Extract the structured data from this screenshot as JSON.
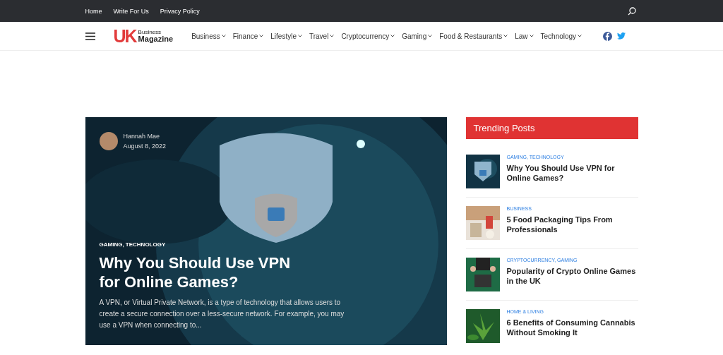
{
  "top_bar": {
    "links": [
      {
        "label": "Home"
      },
      {
        "label": "Write For Us"
      },
      {
        "label": "Privacy Policy"
      }
    ]
  },
  "logo": {
    "mark": "UK",
    "top": "Business",
    "bottom": "Magazine"
  },
  "nav": [
    {
      "label": "Business"
    },
    {
      "label": "Finance"
    },
    {
      "label": "Lifestyle"
    },
    {
      "label": "Travel"
    },
    {
      "label": "Cryptocurrency"
    },
    {
      "label": "Gaming"
    },
    {
      "label": "Food & Restaurants"
    },
    {
      "label": "Law"
    },
    {
      "label": "Technology"
    }
  ],
  "featured": {
    "author": "Hannah Mae",
    "date": "August 8, 2022",
    "categories": "GAMING, TECHNOLOGY",
    "title": "Why You Should Use VPN for Online Games?",
    "excerpt": "A VPN, or Virtual Private Network, is a type of technology that allows users to create a secure connection over a less-secure network. For example, you may use a VPN when connecting to..."
  },
  "trending": {
    "title": "Trending Posts",
    "posts": [
      {
        "kind": "vpn",
        "categories": "GAMING, TECHNOLOGY",
        "title": "Why You Should Use VPN for Online Games?"
      },
      {
        "kind": "food",
        "categories": "BUSINESS",
        "title": "5 Food Packaging Tips From Professionals"
      },
      {
        "kind": "casino",
        "categories": "CRYPTOCURRENCY, GAMING",
        "title": "Popularity of Crypto Online Games in the UK"
      },
      {
        "kind": "plant",
        "categories": "HOME & LIVING",
        "title": "6 Benefits of Consuming Cannabis Without Smoking It"
      }
    ]
  }
}
